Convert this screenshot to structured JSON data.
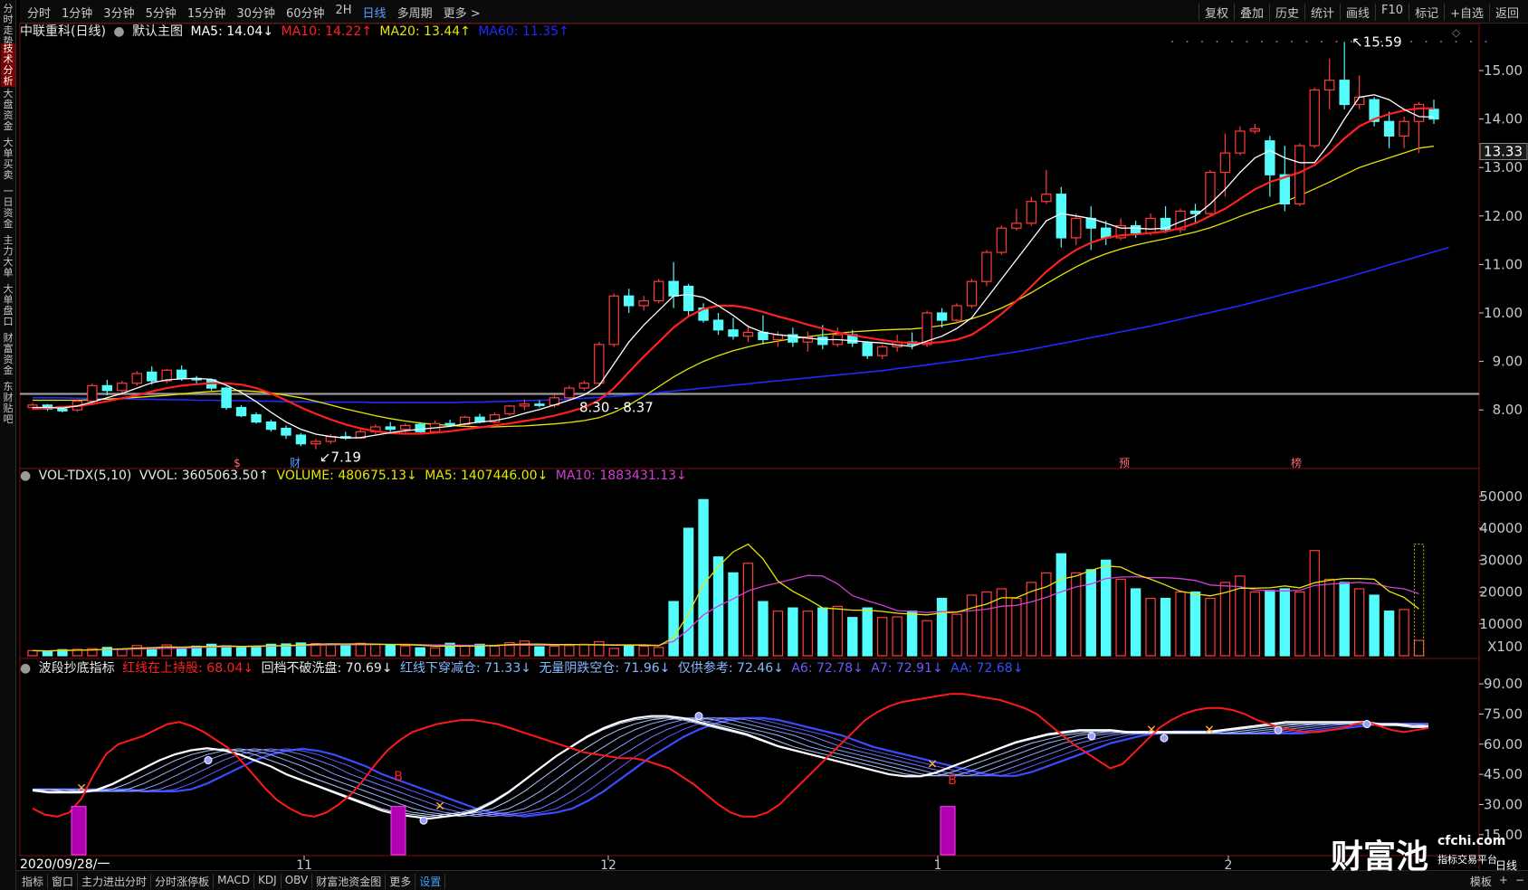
{
  "left_sidebar": [
    "分时走势",
    "技术分析",
    "大盘资金",
    "大单买卖",
    "一日资金",
    "主力大单",
    "大单盘口",
    "财富资金",
    "东财贴吧"
  ],
  "periods": [
    "分时",
    "1分钟",
    "3分钟",
    "5分钟",
    "15分钟",
    "30分钟",
    "60分钟",
    "2H",
    "日线",
    "多周期",
    "更多 >"
  ],
  "active_period": "日线",
  "right_tools": [
    "复权",
    "叠加",
    "历史",
    "统计",
    "画线",
    "F10",
    "标记",
    "+自选",
    "返回"
  ],
  "main_header": {
    "stock": "中联重科(日线)",
    "template": "默认主图",
    "ma5": "MA5: 14.04↓",
    "ma10": "MA10: 14.22↑",
    "ma20": "MA20: 13.44↑",
    "ma60": "MA60: 11.35↑"
  },
  "colors": {
    "up": "#ff3c3c",
    "down": "#54fcfc",
    "ma5": "#ffffff",
    "ma10": "#ff2020",
    "ma20": "#e6e600",
    "ma60": "#1e2aff",
    "vma10": "#d040d0",
    "purple": "#6a5cff"
  },
  "price_axis": [
    "15.00",
    "14.00",
    "13.00",
    "12.00",
    "11.00",
    "10.00",
    "9.00",
    "8.00"
  ],
  "price_axis_values": [
    15,
    14,
    13,
    12,
    11,
    10,
    9,
    8
  ],
  "price_axis_tag": "13.33",
  "annotations": {
    "high": "15.59",
    "low": "7.19",
    "range": "8.30 - 8.37"
  },
  "markers": [
    {
      "text": "$"
    },
    {
      "text": "财"
    },
    {
      "text": "预"
    },
    {
      "text": "榜"
    }
  ],
  "vol_header": {
    "name": "VOL-TDX(5,10)",
    "vvol": "VVOL: 3605063.50↑",
    "volume": "VOLUME: 480675.13↓",
    "ma5": "MA5: 1407446.00↓",
    "ma10": "MA10: 1883431.13↓"
  },
  "vol_axis": [
    "50000",
    "40000",
    "30000",
    "20000",
    "10000",
    "X100"
  ],
  "vol_axis_values": [
    50000,
    40000,
    30000,
    20000,
    10000
  ],
  "ind_header": {
    "name": "波段抄底指标",
    "l1": "红线在上持股: 68.04↓",
    "l2": "回档不破洗盘: 70.69↓",
    "l3": "红线下穿减仓: 71.33↓",
    "l4": "无量阴跌空仓: 71.96↓",
    "l5": "仅供参考: 72.46↓",
    "l6": "A6: 72.78↓",
    "l7": "A7: 72.91↓",
    "l8": "AA: 72.68↓"
  },
  "ind_axis": [
    "90.00",
    "75.00",
    "60.00",
    "45.00",
    "30.00",
    "15.00"
  ],
  "ind_axis_values": [
    90,
    75,
    60,
    45,
    30,
    15
  ],
  "b_labels": [
    "B",
    "B"
  ],
  "date_axis": {
    "start": "2020/09/28/一",
    "months": [
      "11",
      "12",
      "1",
      "2"
    ]
  },
  "bottom_tabs": [
    "指标",
    "窗口",
    "主力进出分时",
    "分时涨停板",
    "MACD",
    "KDJ",
    "OBV",
    "财富池资金图",
    "更多",
    "设置"
  ],
  "bottom_active": "设置",
  "bottom_right": [
    "模板",
    "+",
    "−"
  ],
  "watermark": {
    "main": "财富池",
    "site": "cfchi.com",
    "sub": "指标交易平台",
    "extra": "日线"
  },
  "chart_data": {
    "type": "candlestick",
    "candles": [
      [
        8.05,
        8.15,
        8.0,
        8.1
      ],
      [
        8.1,
        8.12,
        7.98,
        8.02
      ],
      [
        8.02,
        8.08,
        7.95,
        7.98
      ],
      [
        8.0,
        8.22,
        7.96,
        8.18
      ],
      [
        8.18,
        8.55,
        8.12,
        8.5
      ],
      [
        8.5,
        8.62,
        8.3,
        8.4
      ],
      [
        8.4,
        8.6,
        8.35,
        8.55
      ],
      [
        8.55,
        8.8,
        8.5,
        8.75
      ],
      [
        8.78,
        8.9,
        8.52,
        8.6
      ],
      [
        8.6,
        8.85,
        8.55,
        8.82
      ],
      [
        8.82,
        8.92,
        8.6,
        8.65
      ],
      [
        8.65,
        8.7,
        8.55,
        8.62
      ],
      [
        8.62,
        8.65,
        8.4,
        8.45
      ],
      [
        8.45,
        8.48,
        8.0,
        8.05
      ],
      [
        8.05,
        8.1,
        7.85,
        7.88
      ],
      [
        7.9,
        7.95,
        7.72,
        7.75
      ],
      [
        7.75,
        7.8,
        7.55,
        7.6
      ],
      [
        7.62,
        7.68,
        7.4,
        7.48
      ],
      [
        7.48,
        7.52,
        7.25,
        7.3
      ],
      [
        7.3,
        7.4,
        7.19,
        7.35
      ],
      [
        7.35,
        7.5,
        7.3,
        7.45
      ],
      [
        7.45,
        7.55,
        7.38,
        7.42
      ],
      [
        7.42,
        7.6,
        7.4,
        7.55
      ],
      [
        7.55,
        7.7,
        7.5,
        7.65
      ],
      [
        7.65,
        7.75,
        7.55,
        7.6
      ],
      [
        7.6,
        7.72,
        7.5,
        7.68
      ],
      [
        7.7,
        7.75,
        7.5,
        7.55
      ],
      [
        7.55,
        7.78,
        7.52,
        7.72
      ],
      [
        7.72,
        7.8,
        7.65,
        7.7
      ],
      [
        7.7,
        7.88,
        7.68,
        7.85
      ],
      [
        7.85,
        7.92,
        7.72,
        7.75
      ],
      [
        7.75,
        7.95,
        7.72,
        7.9
      ],
      [
        7.92,
        8.1,
        7.88,
        8.08
      ],
      [
        8.08,
        8.22,
        8.0,
        8.12
      ],
      [
        8.12,
        8.2,
        8.05,
        8.1
      ],
      [
        8.1,
        8.3,
        8.05,
        8.25
      ],
      [
        8.25,
        8.5,
        8.2,
        8.45
      ],
      [
        8.45,
        8.6,
        8.4,
        8.55
      ],
      [
        8.55,
        9.4,
        8.5,
        9.35
      ],
      [
        9.35,
        10.4,
        9.3,
        10.35
      ],
      [
        10.35,
        10.5,
        10.0,
        10.15
      ],
      [
        10.15,
        10.35,
        10.05,
        10.25
      ],
      [
        10.25,
        10.7,
        10.2,
        10.65
      ],
      [
        10.65,
        11.05,
        10.1,
        10.35
      ],
      [
        10.55,
        10.6,
        9.95,
        10.05
      ],
      [
        10.1,
        10.2,
        9.8,
        9.85
      ],
      [
        9.85,
        10.0,
        9.55,
        9.65
      ],
      [
        9.65,
        9.9,
        9.45,
        9.52
      ],
      [
        9.52,
        9.75,
        9.4,
        9.6
      ],
      [
        9.6,
        9.95,
        9.35,
        9.45
      ],
      [
        9.45,
        9.62,
        9.3,
        9.55
      ],
      [
        9.55,
        9.7,
        9.3,
        9.4
      ],
      [
        9.4,
        9.62,
        9.2,
        9.5
      ],
      [
        9.5,
        9.75,
        9.25,
        9.35
      ],
      [
        9.35,
        9.7,
        9.3,
        9.55
      ],
      [
        9.55,
        9.65,
        9.3,
        9.38
      ],
      [
        9.38,
        9.42,
        9.05,
        9.12
      ],
      [
        9.12,
        9.35,
        9.05,
        9.3
      ],
      [
        9.3,
        9.55,
        9.2,
        9.4
      ],
      [
        9.4,
        9.6,
        9.25,
        9.35
      ],
      [
        9.35,
        10.05,
        9.3,
        10.0
      ],
      [
        10.0,
        10.1,
        9.7,
        9.85
      ],
      [
        9.85,
        10.2,
        9.8,
        10.15
      ],
      [
        10.15,
        10.7,
        10.1,
        10.65
      ],
      [
        10.65,
        11.3,
        10.55,
        11.25
      ],
      [
        11.25,
        11.8,
        11.2,
        11.75
      ],
      [
        11.75,
        12.15,
        11.7,
        11.85
      ],
      [
        11.85,
        12.4,
        11.8,
        12.3
      ],
      [
        12.3,
        12.95,
        12.25,
        12.45
      ],
      [
        12.45,
        12.6,
        11.35,
        11.55
      ],
      [
        11.55,
        12.05,
        11.4,
        11.95
      ],
      [
        11.95,
        12.2,
        11.3,
        11.75
      ],
      [
        11.75,
        11.9,
        11.4,
        11.55
      ],
      [
        11.55,
        11.95,
        11.5,
        11.8
      ],
      [
        11.8,
        11.9,
        11.55,
        11.65
      ],
      [
        11.65,
        12.05,
        11.6,
        11.95
      ],
      [
        11.95,
        12.2,
        11.65,
        11.72
      ],
      [
        11.72,
        12.15,
        11.65,
        12.1
      ],
      [
        12.1,
        12.25,
        11.85,
        12.05
      ],
      [
        12.05,
        12.95,
        12.0,
        12.9
      ],
      [
        12.9,
        13.7,
        12.4,
        13.3
      ],
      [
        13.3,
        13.85,
        13.25,
        13.75
      ],
      [
        13.75,
        13.9,
        13.7,
        13.8
      ],
      [
        13.55,
        13.65,
        12.4,
        12.85
      ],
      [
        12.85,
        13.45,
        12.1,
        12.25
      ],
      [
        12.25,
        13.5,
        12.2,
        13.45
      ],
      [
        13.45,
        14.65,
        13.4,
        14.6
      ],
      [
        14.6,
        15.25,
        14.2,
        14.8
      ],
      [
        14.8,
        15.59,
        14.2,
        14.3
      ],
      [
        14.3,
        14.9,
        14.2,
        14.45
      ],
      [
        14.4,
        14.45,
        13.85,
        13.95
      ],
      [
        13.95,
        14.15,
        13.4,
        13.65
      ],
      [
        13.65,
        14.05,
        13.4,
        13.95
      ],
      [
        13.95,
        14.35,
        13.3,
        14.3
      ],
      [
        14.2,
        14.4,
        13.9,
        14.0
      ]
    ],
    "vol": [
      1600,
      1400,
      1900,
      2000,
      2200,
      2600,
      2100,
      3200,
      2500,
      3400,
      2300,
      3000,
      3600,
      3100,
      2600,
      2900,
      3600,
      3700,
      4000,
      3800,
      3500,
      3400,
      3900,
      3600,
      3300,
      3100,
      2500,
      2500,
      3900,
      3000,
      3600,
      3000,
      4100,
      4600,
      2800,
      3000,
      3200,
      3600,
      4400,
      2300,
      3300,
      3000,
      2600,
      17000,
      40000,
      49000,
      31000,
      26000,
      29000,
      17000,
      14000,
      15000,
      14000,
      15000,
      15500,
      12000,
      15000,
      12000,
      12200,
      14000,
      11000,
      18000,
      13000,
      19000,
      20000,
      21000,
      18000,
      23000,
      26000,
      32000,
      26000,
      27000,
      30000,
      24000,
      21000,
      18000,
      18000,
      20000,
      20000,
      18000,
      23000,
      25000,
      20000,
      20500,
      21000,
      20000,
      33000,
      24000,
      23000,
      21000,
      19000,
      14000,
      14500,
      4800
    ],
    "ma5_price": [
      8.05,
      8.05,
      8.04,
      8.08,
      8.16,
      8.25,
      8.34,
      8.45,
      8.56,
      8.62,
      8.64,
      8.65,
      8.63,
      8.51,
      8.36,
      8.17,
      7.95,
      7.75,
      7.6,
      7.5,
      7.45,
      7.42,
      7.43,
      7.48,
      7.53,
      7.57,
      7.6,
      7.63,
      7.66,
      7.71,
      7.75,
      7.78,
      7.84,
      7.93,
      8.01,
      8.1,
      8.2,
      8.31,
      8.5,
      8.95,
      9.4,
      9.75,
      10.05,
      10.35,
      10.38,
      10.32,
      10.15,
      9.95,
      9.72,
      9.6,
      9.55,
      9.52,
      9.48,
      9.45,
      9.45,
      9.43,
      9.4,
      9.38,
      9.34,
      9.31,
      9.42,
      9.52,
      9.68,
      9.9,
      10.3,
      10.7,
      11.1,
      11.5,
      11.9,
      12.05,
      12.0,
      11.95,
      11.85,
      11.75,
      11.75,
      11.73,
      11.75,
      11.88,
      12.0,
      12.25,
      12.55,
      12.9,
      13.2,
      13.35,
      13.2,
      13.1,
      13.1,
      13.5,
      14.0,
      14.45,
      14.5,
      14.4,
      14.2,
      14.05,
      14.04
    ],
    "ma10_price": [
      8.02,
      8.04,
      8.06,
      8.08,
      8.12,
      8.18,
      8.24,
      8.3,
      8.38,
      8.45,
      8.5,
      8.53,
      8.55,
      8.55,
      8.52,
      8.45,
      8.34,
      8.2,
      8.05,
      7.92,
      7.8,
      7.7,
      7.62,
      7.56,
      7.52,
      7.51,
      7.51,
      7.53,
      7.56,
      7.6,
      7.64,
      7.68,
      7.72,
      7.77,
      7.82,
      7.88,
      7.96,
      8.05,
      8.2,
      8.45,
      8.78,
      9.1,
      9.4,
      9.7,
      9.93,
      10.08,
      10.15,
      10.15,
      10.1,
      10.02,
      9.93,
      9.85,
      9.76,
      9.68,
      9.6,
      9.54,
      9.49,
      9.44,
      9.4,
      9.38,
      9.38,
      9.4,
      9.45,
      9.55,
      9.75,
      9.98,
      10.25,
      10.55,
      10.85,
      11.1,
      11.3,
      11.45,
      11.55,
      11.6,
      11.62,
      11.65,
      11.68,
      11.75,
      11.85,
      12.0,
      12.15,
      12.35,
      12.55,
      12.7,
      12.8,
      12.9,
      13.05,
      13.3,
      13.6,
      13.85,
      14.0,
      14.1,
      14.18,
      14.22,
      14.22
    ],
    "ma20_price": [
      8.2,
      8.2,
      8.2,
      8.2,
      8.21,
      8.22,
      8.24,
      8.26,
      8.28,
      8.3,
      8.33,
      8.36,
      8.38,
      8.4,
      8.4,
      8.38,
      8.35,
      8.3,
      8.25,
      8.18,
      8.1,
      8.02,
      7.95,
      7.88,
      7.82,
      7.77,
      7.73,
      7.7,
      7.68,
      7.66,
      7.65,
      7.65,
      7.66,
      7.67,
      7.69,
      7.71,
      7.74,
      7.78,
      7.84,
      7.95,
      8.1,
      8.28,
      8.48,
      8.68,
      8.85,
      9.0,
      9.12,
      9.22,
      9.3,
      9.37,
      9.42,
      9.47,
      9.51,
      9.55,
      9.58,
      9.61,
      9.63,
      9.65,
      9.66,
      9.67,
      9.7,
      9.74,
      9.8,
      9.88,
      9.98,
      10.1,
      10.25,
      10.42,
      10.6,
      10.78,
      10.95,
      11.1,
      11.22,
      11.32,
      11.4,
      11.47,
      11.53,
      11.6,
      11.67,
      11.76,
      11.87,
      11.99,
      12.1,
      12.2,
      12.3,
      12.42,
      12.56,
      12.7,
      12.85,
      13.0,
      13.1,
      13.2,
      13.3,
      13.4,
      13.44
    ],
    "ma60_price": [
      8.25,
      8.25,
      8.25,
      8.24,
      8.24,
      8.23,
      8.23,
      8.22,
      8.22,
      8.21,
      8.21,
      8.2,
      8.2,
      8.19,
      8.19,
      8.18,
      8.18,
      8.17,
      8.17,
      8.16,
      8.16,
      8.16,
      8.16,
      8.15,
      8.15,
      8.15,
      8.15,
      8.15,
      8.15,
      8.16,
      8.16,
      8.17,
      8.18,
      8.19,
      8.2,
      8.21,
      8.22,
      8.24,
      8.26,
      8.28,
      8.3,
      8.33,
      8.36,
      8.39,
      8.42,
      8.45,
      8.48,
      8.51,
      8.54,
      8.57,
      8.6,
      8.63,
      8.66,
      8.69,
      8.72,
      8.75,
      8.78,
      8.81,
      8.85,
      8.89,
      8.93,
      8.97,
      9.01,
      9.05,
      9.1,
      9.15,
      9.2,
      9.25,
      9.31,
      9.37,
      9.43,
      9.49,
      9.55,
      9.61,
      9.67,
      9.73,
      9.8,
      9.87,
      9.94,
      10.01,
      10.08,
      10.15,
      10.23,
      10.31,
      10.39,
      10.47,
      10.55,
      10.63,
      10.72,
      10.81,
      10.9,
      10.99,
      11.08,
      11.17,
      11.26,
      11.35
    ],
    "ind_red": [
      28,
      25,
      24,
      26,
      33,
      45,
      55,
      60,
      62,
      64,
      67,
      70,
      71,
      69,
      66,
      62,
      58,
      52,
      45,
      38,
      32,
      28,
      25,
      24,
      26,
      30,
      35,
      42,
      50,
      57,
      62,
      66,
      68,
      70,
      71,
      72,
      72,
      71,
      70,
      68,
      66,
      64,
      62,
      60,
      58,
      56,
      55,
      54,
      53,
      53,
      52,
      50,
      48,
      44,
      40,
      35,
      30,
      26,
      24,
      24,
      26,
      30,
      36,
      42,
      48,
      54,
      60,
      66,
      72,
      76,
      79,
      81,
      82,
      83,
      84,
      85,
      85,
      84,
      83,
      82,
      80,
      78,
      75,
      70,
      65,
      60,
      56,
      52,
      48,
      50,
      56,
      62,
      68,
      72,
      75,
      77,
      78,
      78,
      77,
      75,
      72,
      70,
      68,
      67,
      66,
      66,
      67,
      68,
      70,
      71,
      69,
      67,
      66,
      67,
      68
    ],
    "ind_white": [
      37,
      36,
      36,
      36,
      37,
      40,
      44,
      48,
      52,
      55,
      57,
      58,
      57,
      55,
      52,
      49,
      45,
      42,
      39,
      36,
      33,
      30,
      27,
      25,
      24,
      23,
      24,
      25,
      27,
      31,
      36,
      42,
      48,
      54,
      59,
      64,
      68,
      71,
      73,
      74,
      74,
      73,
      71,
      69,
      67,
      65,
      62,
      59,
      57,
      55,
      53,
      51,
      49,
      47,
      45,
      44,
      44,
      46,
      49,
      52,
      55,
      58,
      61,
      63,
      65,
      66,
      67,
      67,
      67,
      66,
      66,
      66,
      66,
      66,
      66,
      67,
      68,
      69,
      70,
      71,
      71,
      71,
      71,
      71,
      71,
      70,
      70,
      69,
      69
    ]
  }
}
